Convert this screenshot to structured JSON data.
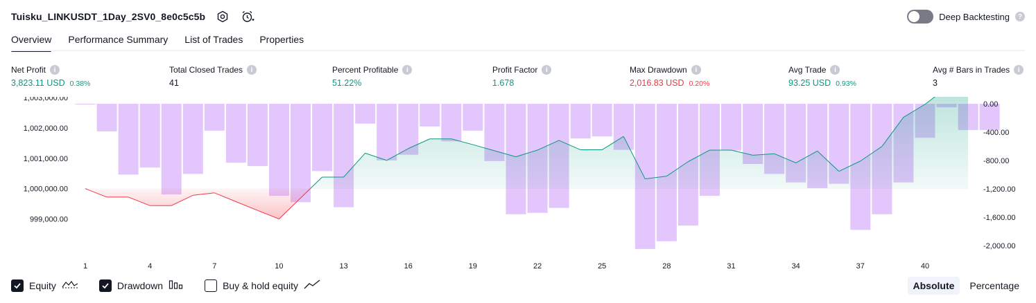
{
  "header": {
    "title": "Tuisku_LINKUSDT_1Day_2SV0_8e0c5c5b",
    "settings_icon": "hexagon-gear-icon",
    "alert_icon": "alarm-clock-plus-icon"
  },
  "deep_backtesting": {
    "label": "Deep Backtesting",
    "enabled": false
  },
  "tabs": [
    {
      "label": "Overview",
      "active": true
    },
    {
      "label": "Performance Summary",
      "active": false
    },
    {
      "label": "List of Trades",
      "active": false
    },
    {
      "label": "Properties",
      "active": false
    }
  ],
  "metrics": [
    {
      "label": "Net Profit",
      "value": "3,823.11 USD",
      "sub": "0.38%",
      "color": "#089981"
    },
    {
      "label": "Total Closed Trades",
      "value": "41",
      "sub": "",
      "color": "#131722"
    },
    {
      "label": "Percent Profitable",
      "value": "51.22%",
      "sub": "",
      "color": "#089981"
    },
    {
      "label": "Profit Factor",
      "value": "1.678",
      "sub": "",
      "color": "#089981"
    },
    {
      "label": "Max Drawdown",
      "value": "2,016.83 USD",
      "sub": "0.20%",
      "color": "#f23645"
    },
    {
      "label": "Avg Trade",
      "value": "93.25 USD",
      "sub": "0.93%",
      "color": "#089981"
    },
    {
      "label": "Avg # Bars in Trades",
      "value": "3",
      "sub": "",
      "color": "#131722"
    }
  ],
  "chart_data": {
    "type": "line",
    "baseline": 1000000,
    "x_ticks": [
      "1",
      "4",
      "7",
      "10",
      "13",
      "16",
      "19",
      "22",
      "25",
      "28",
      "31",
      "34",
      "37",
      "40"
    ],
    "y_left_ticks": [
      "1,003,000.00",
      "1,002,000.00",
      "1,001,000.00",
      "1,000,000.00",
      "999,000.00"
    ],
    "y_right_ticks": [
      "0.00",
      "-400.00",
      "-800.00",
      "-1,200.00",
      "-1,600.00",
      "-2,000.00"
    ],
    "ylim_left": [
      998650,
      1003800
    ],
    "ylim_right": [
      -2100,
      0
    ],
    "series": [
      {
        "name": "Equity",
        "values": [
          1000000,
          999720,
          999720,
          999440,
          999440,
          999780,
          999860,
          999570,
          999280,
          999000,
          999690,
          1000380,
          1000380,
          1001170,
          1000930,
          1001320,
          1001640,
          1001640,
          1001450,
          1001250,
          1001050,
          1001270,
          1001590,
          1001280,
          1001280,
          1001720,
          1000320,
          1000410,
          1000890,
          1001270,
          1001270,
          1001100,
          1001150,
          1000850,
          1001240,
          1000570,
          1000910,
          1001390,
          1002350,
          1002780,
          1003320,
          1003830
        ]
      },
      {
        "name": "Drawdown",
        "values": [
          -10,
          -390,
          -1000,
          -900,
          -1280,
          -990,
          -380,
          -830,
          -880,
          -1300,
          -1390,
          -950,
          -1460,
          -280,
          -800,
          -720,
          -320,
          -530,
          -380,
          -810,
          -1560,
          -1540,
          -1470,
          -490,
          -460,
          -650,
          -2050,
          -1940,
          -1720,
          -1300,
          -660,
          -850,
          -990,
          -1110,
          -1190,
          -1130,
          -1780,
          -1560,
          -1110,
          -480,
          -50,
          -370,
          -370
        ]
      }
    ],
    "legend": "bottom"
  },
  "legend_items": [
    {
      "label": "Equity",
      "checked": true,
      "icon": "equity-line-icon"
    },
    {
      "label": "Drawdown",
      "checked": true,
      "icon": "drawdown-bars-icon"
    },
    {
      "label": "Buy & hold equity",
      "checked": false,
      "icon": "buy-hold-line-icon"
    }
  ],
  "mode": {
    "absolute": "Absolute",
    "percentage": "Percentage",
    "selected": "Absolute"
  },
  "colors": {
    "profit": "#089981",
    "loss": "#f23645",
    "drawdown_bar": "#e1c3fb",
    "text": "#131722"
  }
}
